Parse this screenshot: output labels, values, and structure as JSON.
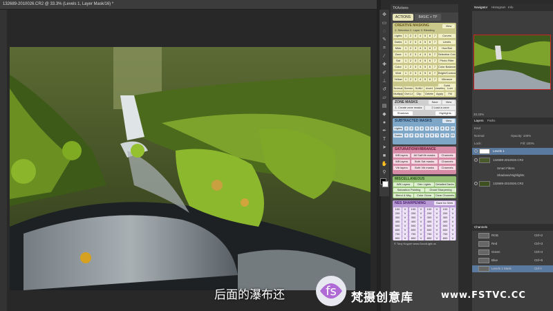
{
  "document": {
    "tab_title": "132689-2010026.CR2 @ 33.3% (Levels 1, Layer Mask/16) *"
  },
  "actions_panel": {
    "header": "TKActions",
    "tabs": [
      "ACTIONS",
      "BASIC + TP"
    ],
    "creative_title": "CREATIVE MASKING",
    "creative_sub": "1. Selection 2. Layer 3. Blending",
    "view": "View",
    "cm_labels": [
      "Lights",
      "Darks",
      "Mids",
      "Zone",
      "Sat",
      "Color",
      "Vivid",
      "Yellow"
    ],
    "cm_num": [
      "1",
      "2",
      "3",
      "4",
      "5",
      "6",
      "7"
    ],
    "cm_right": [
      "Curves",
      "Levels",
      "Hue/Sat",
      "Selective Color",
      "Photo Filter",
      "Color Balance",
      "Bright/Contrast",
      "Vibrance",
      "Solid"
    ],
    "blend": [
      "Normal",
      "Screen",
      "SoftLt",
      "Invert",
      "Unselect",
      "Lum",
      "Multiply",
      "Ovrl.Lt",
      "Clip",
      "Delete",
      "Apply",
      "Fill"
    ],
    "zone_title": "ZONE MASKS",
    "zone_save": "Save",
    "zone_view": "View",
    "zone_create": "1. Create zone masks",
    "zone_load": "2.Load a zone",
    "zone_shadows": "Shadows",
    "zone_highlights": "Highlights",
    "sub_title": "SUBTRACTED MASKS",
    "sub_view": "View",
    "sub_lights": "Lights",
    "sub_darks": "Darks",
    "sat_title": "SATURATION/VIBRANCE",
    "sat_rows": [
      [
        "WB layers",
        "All Sat/Vib masks",
        "Channels"
      ],
      [
        "WB layers",
        "Both Sat masks",
        "Channels"
      ],
      [
        "Vib layers",
        "Both Vib masks",
        "Channels"
      ]
    ],
    "misc_title": "MISCELLANEOUS",
    "misc_rows": [
      [
        "WB Layers",
        "Ortn Lights",
        "Detailed Darks"
      ],
      [
        "Saturation Painting",
        "Ghost Sharpening"
      ],
      [
        "Blend & Mrg",
        "Color Clone",
        "Clear Channels"
      ]
    ],
    "nes_title": "NES SHARPENING",
    "nes_save": "Save for Web",
    "nes_sizes": [
      "100",
      "200",
      "300",
      "400",
      "500",
      "600",
      "700",
      "800"
    ],
    "footer": "© Tony Kuyper www.GoodLight.us"
  },
  "navigator": {
    "tabs": [
      "Navigator",
      "Histogram",
      "Info"
    ],
    "zoom": "33.33%"
  },
  "layers": {
    "tabs": [
      "Layers",
      "Paths"
    ],
    "kind": "Kind",
    "mode": "Normal",
    "opacity": "Opacity: 100%",
    "lock": "Lock:",
    "fill": "Fill: 100%",
    "rows": [
      "Levels 1",
      "132689-2010026.CR2",
      "Smart Filters",
      "Shadows/Highlights",
      "132689-2010026.CR2"
    ]
  },
  "channels": {
    "tab": "Channels",
    "rows": [
      [
        "RGB",
        "Ctrl+2"
      ],
      [
        "Red",
        "Ctrl+3"
      ],
      [
        "Green",
        "Ctrl+4"
      ],
      [
        "Blue",
        "Ctrl+5"
      ],
      [
        "Levels 1 Mask",
        "Ctrl+\\"
      ]
    ]
  },
  "overlay": {
    "subtitle": "后面的瀑布还",
    "brand": "梵摄创意库",
    "url": "www.FSTVC.CC"
  },
  "colors": {
    "cm_bg": "#d6d49a",
    "sat_bg": "#e2a3b8",
    "misc_bg": "#a9cf8d",
    "nes_bg": "#c9b3e0",
    "sub_bg": "#8fb7d8"
  }
}
